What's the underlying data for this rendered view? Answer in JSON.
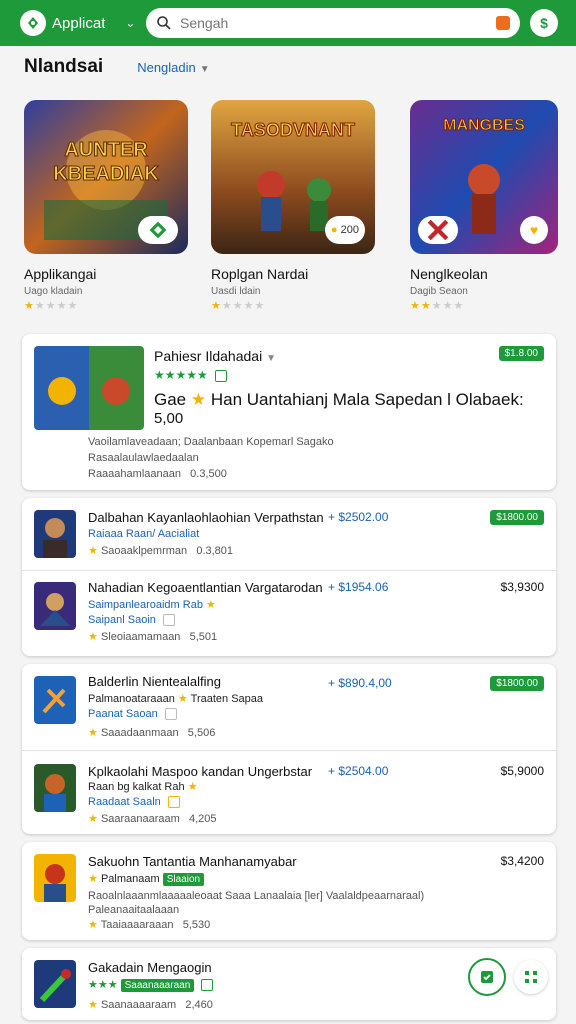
{
  "topbar": {
    "app_name": "Applicat",
    "search_placeholder": "Sengah",
    "action_glyph": "$"
  },
  "section": {
    "title": "Nlandsai",
    "filter": "Nengladin"
  },
  "featured": [
    {
      "art_text": "AUNTER KBEADIAK",
      "title": "Applikangai",
      "sub": "Uago kladain",
      "rating": 1,
      "chip": ""
    },
    {
      "art_text": "TASODVNANT",
      "title": "Roplgan Nardai",
      "sub": "Uasdi ldain",
      "rating": 1,
      "chip": "200"
    },
    {
      "art_text": "MANGBES",
      "title": "Nenglkeolan",
      "sub": "Dagib Seaon",
      "rating": 2,
      "chip": ""
    }
  ],
  "promo": {
    "title": "Pahiesr Ildahadai",
    "badge": "$1.8.00",
    "headline": "Gae",
    "headline_rest": "Han Uantahianj  Mala  Sapedan l Olabaek:",
    "headline_value": "5,00",
    "desc": "Vaoilamlaveadaan; Daalanbaan Kopemarl Sagako",
    "desc2": "Rasaalaulawlaedaalan",
    "meta_left": "Raaaahamlaanaan",
    "meta_right": "0.3,500"
  },
  "group1": [
    {
      "title": "Dalbahan Kayanlaohlaohian Verpathstan",
      "sub": "Raiaaa Raan/ Aacialiat",
      "price_blue": "+ $2502.00",
      "badge": "$1800.00",
      "price": "",
      "meta_left": "Saoaaklpemrman",
      "meta_right": "0.3,801"
    },
    {
      "title": "Nahadian Kegoaentlantian Vargatarodan",
      "sub": "Saimpanlearoaidm Rab",
      "price_blue": "+ $1954.06",
      "badge": "",
      "price": "$3,9300",
      "meta_left": "Sleoiaamamaan",
      "meta_right": "5,501"
    }
  ],
  "group2": [
    {
      "title": "Balderlin Nientealalfing",
      "sub": "Palmanoataraaan",
      "sub_extra": "Traaten Sapaa",
      "tag": "Paanat Saoan",
      "price_blue": "+ $890.4,00",
      "badge": "$1800.00",
      "price": "",
      "meta_left": "Saaadaanmaan",
      "meta_right": "5,506"
    },
    {
      "title": "Kplkaolahi Maspoo kandan Ungerbstar",
      "sub": "Raan bg kalkat Rah",
      "tag": "Raadaat Saaln",
      "price_blue": "+ $2504.00",
      "badge": "",
      "price": "$5,9000",
      "meta_left": "Saaraanaaraam",
      "meta_right": "4,205"
    }
  ],
  "row_d": {
    "title": "Sakuohn Tantantia Manhanamyabar",
    "sub": "Palmanaam",
    "chip": "Slaaion",
    "price": "$3,4200",
    "desc": "Raoalnlaaanmlaaaaaleoaat Saaa Lanaalaia [ler] Vaalaldpeaarnaraal)",
    "desc2": "Paleanaaitaalaaan",
    "meta_left": "Taaiaaaaraaan",
    "meta_right": "5,530"
  },
  "row_e": {
    "title": "Gakadain Mengaogin",
    "chip": "Saaanaaaraan",
    "meta_left": "Saanaaaaraam",
    "meta_right": "2,460"
  },
  "colors": {
    "accent": "#1e9a3a",
    "link": "#1a62b8",
    "star": "#f2b400"
  }
}
